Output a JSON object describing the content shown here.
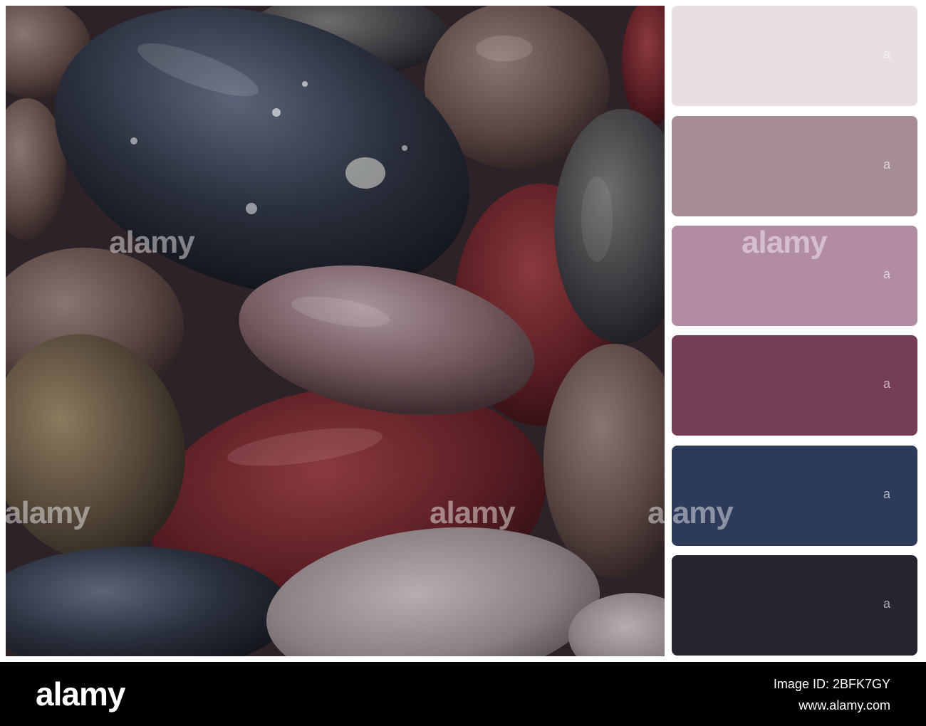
{
  "photo": {
    "subject": "wet-pebbles",
    "watermark": "alamy"
  },
  "palette": {
    "swatches": [
      {
        "color": "#e8dfe1",
        "mark": "a"
      },
      {
        "color": "#a68d94",
        "mark": "a"
      },
      {
        "color": "#b28ba5",
        "mark": "a"
      },
      {
        "color": "#753e56",
        "mark": "a"
      },
      {
        "color": "#2d3a5a",
        "mark": "a"
      },
      {
        "color": "#26242f",
        "mark": "a"
      }
    ]
  },
  "footer": {
    "brand": "alamy",
    "image_id": "Image ID: 2BFK7GY",
    "site": "www.alamy.com"
  }
}
